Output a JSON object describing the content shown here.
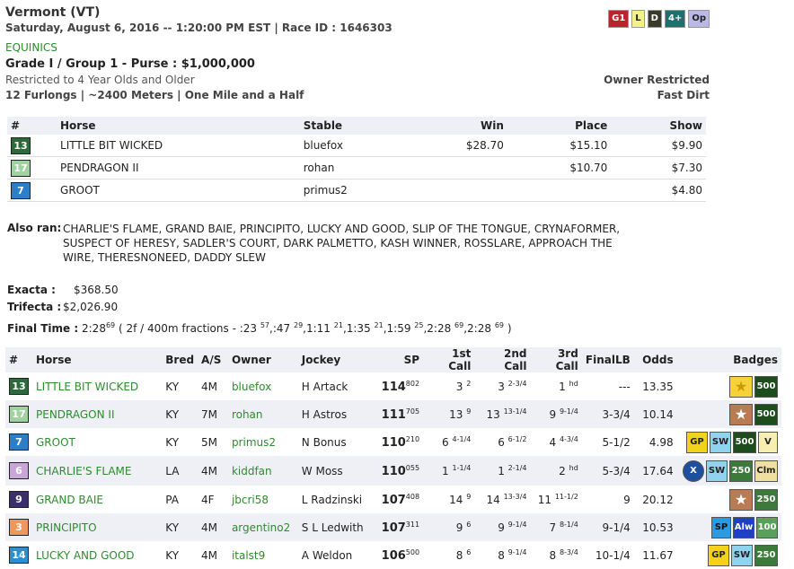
{
  "header": {
    "title": "Vermont (VT)",
    "datetime": "Saturday, August 6, 2016 -- 1:20:00 PM EST | Race ID : 1646303",
    "stable_link": "EQUINICS",
    "grade": "Grade I / Group 1 - Purse : $1,000,000",
    "restriction": "Restricted to 4 Year Olds and Older",
    "distance": "12 Furlongs | ~2400 Meters | One Mile and a Half",
    "owner_restricted": "Owner Restricted",
    "surface": "Fast Dirt",
    "tags": [
      {
        "label": "G1",
        "bg": "#b8262b",
        "fg": "#fff"
      },
      {
        "label": "L",
        "bg": "#f3f18a",
        "fg": "#222"
      },
      {
        "label": "D",
        "bg": "#3a3a2a",
        "fg": "#fff"
      },
      {
        "label": "4+",
        "bg": "#1f6f6f",
        "fg": "#fff"
      },
      {
        "label": "Op",
        "bg": "#b9b9e6",
        "fg": "#222"
      }
    ]
  },
  "summary": {
    "headers": [
      "#",
      "Horse",
      "Stable",
      "Win",
      "Place",
      "Show"
    ],
    "rows": [
      {
        "num": "13",
        "color": "#2d6a3a",
        "horse": "LITTLE BIT WICKED",
        "stable": "bluefox",
        "win": "$28.70",
        "place": "$15.10",
        "show": "$9.90"
      },
      {
        "num": "17",
        "color": "#9fd29f",
        "horse": "PENDRAGON II",
        "stable": "rohan",
        "win": "",
        "place": "$10.70",
        "show": "$7.30"
      },
      {
        "num": "7",
        "color": "#2c7fc6",
        "horse": "GROOT",
        "stable": "primus2",
        "win": "",
        "place": "",
        "show": "$4.80"
      }
    ]
  },
  "also_ran": {
    "label": "Also ran:",
    "line1": "CHARLIE'S FLAME, GRAND BAIE, PRINCIPITO, LUCKY AND GOOD, SLIP OF THE TONGUE, CRYNAFORMER,",
    "line2": "SUSPECT OF HERESY, SADLER'S COURT, DARK PALMETTO, KASH WINNER, ROSSLARE, APPROACH THE",
    "line3": "WIRE, THERESNONEED, DADDY SLEW"
  },
  "payouts": {
    "exacta_label": "Exacta :",
    "exacta": "$368.50",
    "trifecta_label": "Trifecta :",
    "trifecta": "$2,026.90"
  },
  "final_time": {
    "label": "Final Time :",
    "time": "2:28",
    "time_sup": "69",
    "fractions": [
      {
        "prefix": "( 2f / 400m fractions - :23 ",
        "val": ""
      },
      {
        "sup": "57"
      },
      {
        "txt": ",:47 "
      },
      {
        "sup": "29"
      },
      {
        "txt": ",1:11 "
      },
      {
        "sup": "21"
      },
      {
        "txt": ",1:35 "
      },
      {
        "sup": "21"
      },
      {
        "txt": ",1:59 "
      },
      {
        "sup": "25"
      },
      {
        "txt": ",2:28 "
      },
      {
        "sup": "69"
      },
      {
        "txt": ",2:28 "
      },
      {
        "sup": "69"
      },
      {
        "txt": " )"
      }
    ]
  },
  "main_table": {
    "headers": [
      "#",
      "Horse",
      "Bred",
      "A/S",
      "Owner",
      "Jockey",
      "SP",
      "1st Call",
      "2nd Call",
      "3rd Call",
      "FinalLB",
      "Odds",
      "Badges"
    ],
    "rows": [
      {
        "num": "13",
        "color": "#2d6a3a",
        "horse": "LITTLE BIT WICKED",
        "bred": "KY",
        "as": "4M",
        "owner": "bluefox",
        "jockey": "H Artack",
        "sp": "114",
        "sp_sup": "802",
        "c1": "3",
        "c1s": "2",
        "c2": "3",
        "c2s": "2-3/4",
        "c3": "1",
        "c3s": "hd",
        "final": "---",
        "odds": "13.35",
        "badges": [
          "star-g1",
          "500"
        ]
      },
      {
        "num": "17",
        "color": "#9fd29f",
        "horse": "PENDRAGON II",
        "bred": "KY",
        "as": "7M",
        "owner": "rohan",
        "jockey": "H Astros",
        "sp": "111",
        "sp_sup": "705",
        "c1": "13",
        "c1s": "9",
        "c2": "13",
        "c2s": "13-1/4",
        "c3": "9",
        "c3s": "9-1/4",
        "final": "3-3/4",
        "odds": "10.14",
        "badges": [
          "star-g3",
          "500"
        ]
      },
      {
        "num": "7",
        "color": "#2c7fc6",
        "horse": "GROOT",
        "bred": "KY",
        "as": "5M",
        "owner": "primus2",
        "jockey": "N Bonus",
        "sp": "110",
        "sp_sup": "210",
        "c1": "6",
        "c1s": "4-1/4",
        "c2": "6",
        "c2s": "6-1/2",
        "c3": "4",
        "c3s": "4-3/4",
        "final": "5-1/2",
        "odds": "4.98",
        "badges": [
          "GP",
          "SW",
          "500",
          "V"
        ]
      },
      {
        "num": "6",
        "color": "#c9a6d8",
        "horse": "CHARLIE'S FLAME",
        "bred": "LA",
        "as": "4M",
        "owner": "kiddfan",
        "jockey": "W Moss",
        "sp": "110",
        "sp_sup": "055",
        "c1": "1",
        "c1s": "1-1/4",
        "c2": "1",
        "c2s": "2-1/4",
        "c3": "2",
        "c3s": "hd",
        "final": "5-3/4",
        "odds": "17.64",
        "badges": [
          "X",
          "SW",
          "250",
          "Clm"
        ]
      },
      {
        "num": "9",
        "color": "#3b2f6b",
        "horse": "GRAND BAIE",
        "bred": "PA",
        "as": "4F",
        "owner": "jbcri58",
        "jockey": "L Radzinski",
        "sp": "107",
        "sp_sup": "408",
        "c1": "14",
        "c1s": "9",
        "c2": "14",
        "c2s": "13-3/4",
        "c3": "11",
        "c3s": "11-1/2",
        "final": "9",
        "odds": "20.12",
        "badges": [
          "star-g3",
          "250"
        ]
      },
      {
        "num": "3",
        "color": "#f0965a",
        "horse": "PRINCIPITO",
        "bred": "KY",
        "as": "4M",
        "owner": "argentino2",
        "jockey": "S L Ledwith",
        "sp": "107",
        "sp_sup": "311",
        "c1": "9",
        "c1s": "6",
        "c2": "9",
        "c2s": "9-1/4",
        "c3": "7",
        "c3s": "8-1/4",
        "final": "9-1/4",
        "odds": "10.53",
        "badges": [
          "SP",
          "Alw",
          "100"
        ]
      },
      {
        "num": "14",
        "color": "#2c8fd0",
        "horse": "LUCKY AND GOOD",
        "bred": "KY",
        "as": "4M",
        "owner": "italst9",
        "jockey": "A Weldon",
        "sp": "106",
        "sp_sup": "500",
        "c1": "8",
        "c1s": "6",
        "c2": "8",
        "c2s": "9-1/4",
        "c3": "8",
        "c3s": "8-3/4",
        "final": "10-1/4",
        "odds": "11.67",
        "badges": [
          "GP",
          "SW",
          "250"
        ]
      }
    ]
  }
}
